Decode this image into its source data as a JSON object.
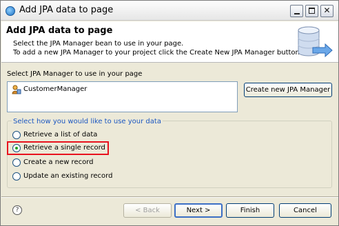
{
  "window": {
    "title": "Add JPA data to page"
  },
  "header": {
    "title": "Add JPA data to page",
    "description_line1": "Select the JPA Manager bean to use in your page.",
    "description_line2": "To add a new JPA Manager to your project click the Create New JPA Manager button.",
    "icon": "database-arrow-icon"
  },
  "manager_section": {
    "label": "Select JPA Manager to use in your page",
    "items": [
      {
        "label": "CustomerManager",
        "icon": "bean-icon"
      }
    ],
    "create_button": "Create new JPA Manager"
  },
  "usage_group": {
    "label": "Select how you would like to use your data",
    "options": [
      {
        "label": "Retrieve a list of data",
        "selected": false
      },
      {
        "label": "Retrieve a single record",
        "selected": true
      },
      {
        "label": "Create a new record",
        "selected": false
      },
      {
        "label": "Update an existing record",
        "selected": false
      }
    ],
    "highlight_color": "#e8121e"
  },
  "footer": {
    "back": "< Back",
    "next": "Next >",
    "finish": "Finish",
    "cancel": "Cancel",
    "help_icon": "help-icon",
    "help_glyph": "?"
  },
  "colors": {
    "group_label": "#1c57c1",
    "radio_selected": "#21a121"
  }
}
